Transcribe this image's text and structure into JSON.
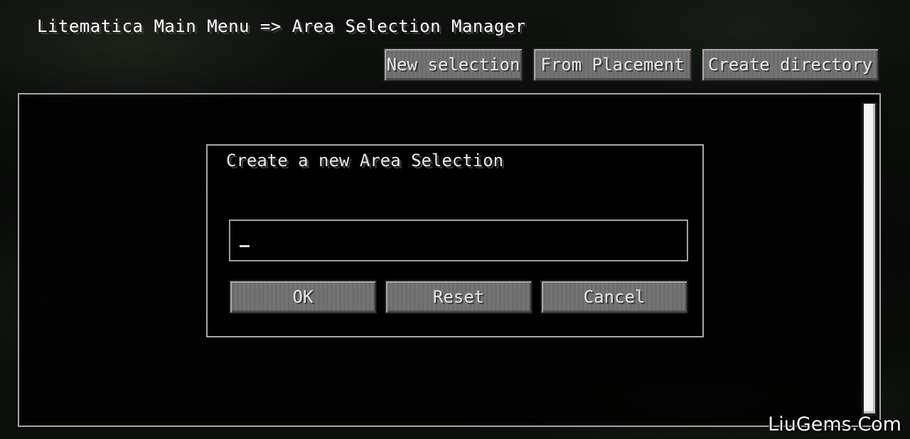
{
  "header": {
    "breadcrumb": "Litematica Main Menu => Area Selection Manager"
  },
  "toolbar": {
    "new_selection_label": "New selection",
    "from_placement_label": "From Placement",
    "create_directory_label": "Create directory"
  },
  "dialog": {
    "title": "Create a new Area Selection",
    "input_value": "",
    "ok_label": "OK",
    "reset_label": "Reset",
    "cancel_label": "Cancel"
  },
  "watermark": {
    "text": "LiuGems.Com"
  },
  "colors": {
    "button_face": "#6f6f6f",
    "panel_border": "#a8a8a8",
    "scrollbar_thumb": "#f2f2f2"
  }
}
